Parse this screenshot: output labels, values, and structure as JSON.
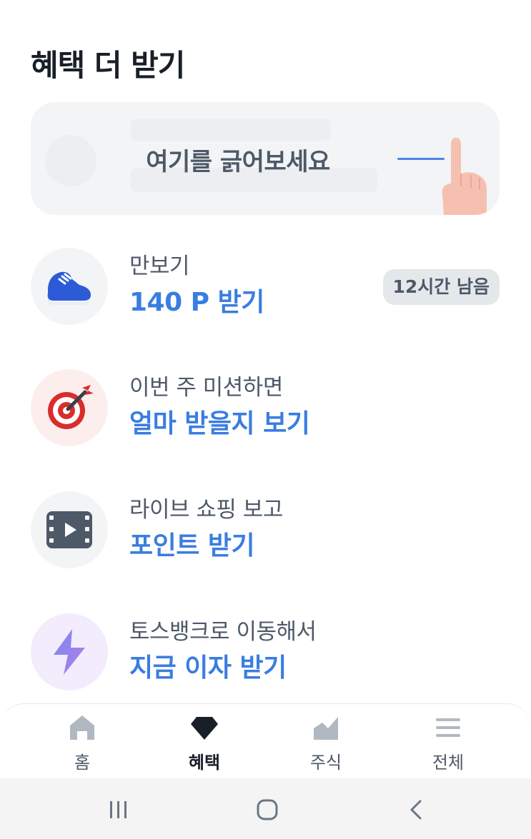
{
  "page": {
    "title": "혜택 더 받기"
  },
  "scratch_card": {
    "label": "여기를 긁어보세요"
  },
  "benefits": [
    {
      "sub": "만보기",
      "main": "140 P 받기",
      "badge": "12시간 남음",
      "icon": "sneaker-icon",
      "icon_bg": "#f2f4f6"
    },
    {
      "sub": "이번 주 미션하면",
      "main": "얼마 받을지 보기",
      "icon": "dart-target-icon",
      "icon_bg": "#fdeeee"
    },
    {
      "sub": "라이브 쇼핑 보고",
      "main": "포인트 받기",
      "icon": "video-play-icon",
      "icon_bg": "#f2f4f6"
    },
    {
      "sub": "토스뱅크로 이동해서",
      "main": "지금 이자 받기",
      "icon": "lightning-icon",
      "icon_bg": "#f3ecfc"
    }
  ],
  "tab_bar": {
    "tabs": [
      {
        "label": "홈",
        "icon": "home-icon",
        "active": false
      },
      {
        "label": "혜택",
        "icon": "gem-icon",
        "active": true
      },
      {
        "label": "주식",
        "icon": "stock-chart-icon",
        "active": false
      },
      {
        "label": "전체",
        "icon": "menu-icon",
        "active": false
      }
    ]
  },
  "system_nav": {
    "buttons": [
      "recent-apps-icon",
      "home-circle-icon",
      "back-icon"
    ]
  },
  "colors": {
    "accent": "#3a7de0",
    "text": "#191f28",
    "sub_text": "#4e5968",
    "card_bg": "#f2f4f6"
  }
}
